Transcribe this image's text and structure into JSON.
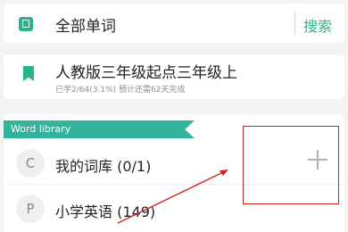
{
  "search_bar": {
    "label": "全部单词",
    "button": "搜索"
  },
  "current_book": {
    "title": "人教版三年级起点三年级上",
    "progress": "已学2/64(3.1%) 预计还需62天完成"
  },
  "library": {
    "section_title": "Word library",
    "items": [
      {
        "letter": "C",
        "label": "我的词库 (0/1)"
      },
      {
        "letter": "P",
        "label": "小学英语 (149)"
      }
    ]
  },
  "colors": {
    "accent": "#2bb38e",
    "ribbon": "#33b39b",
    "annotation": "#cf2020"
  },
  "icons": {
    "search_card": "book-icon",
    "book_card": "bookmark-icon",
    "add": "plus-icon"
  }
}
